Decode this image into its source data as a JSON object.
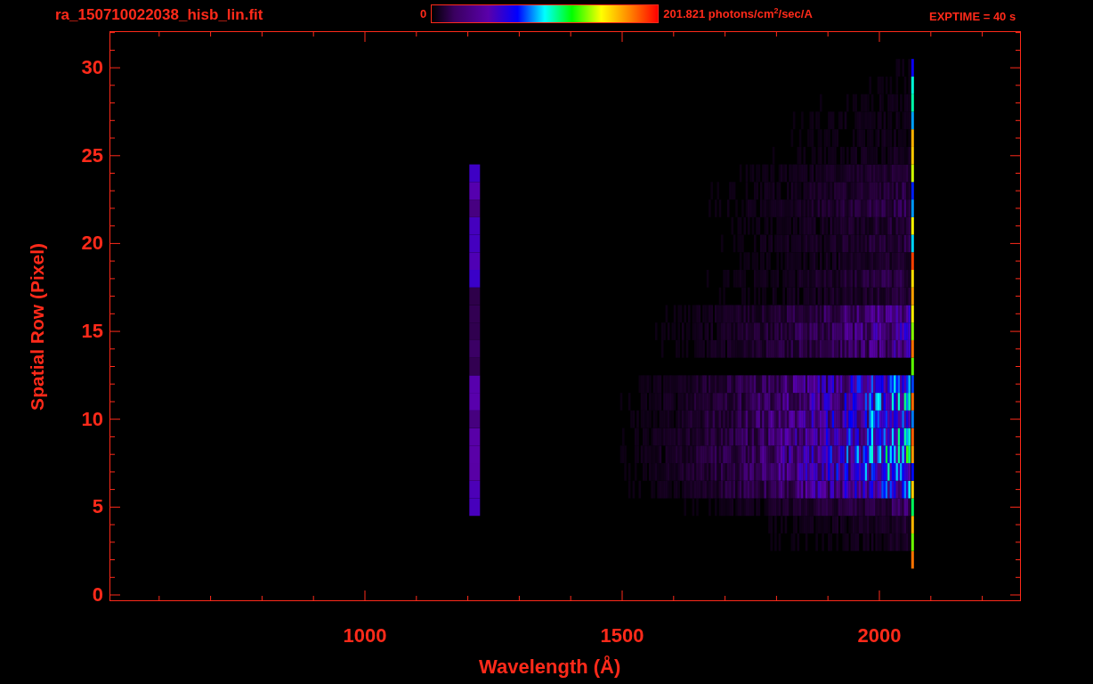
{
  "header": {
    "filename": "ra_150710022038_hisb_lin.fit",
    "colorbar": {
      "min_label": "0",
      "max_label": "201.821 photons/cm$^{2}$/sec/A"
    },
    "exposure": "EXPTIME = 40 s"
  },
  "plot": {
    "xlabel": "Wavelength (Å)",
    "ylabel": "Spatial Row (Pixel)",
    "xtick_labels": [
      "1000",
      "1500",
      "2000"
    ],
    "ytick_labels": [
      "30",
      "25",
      "20",
      "15",
      "10",
      "5",
      "0"
    ]
  }
}
